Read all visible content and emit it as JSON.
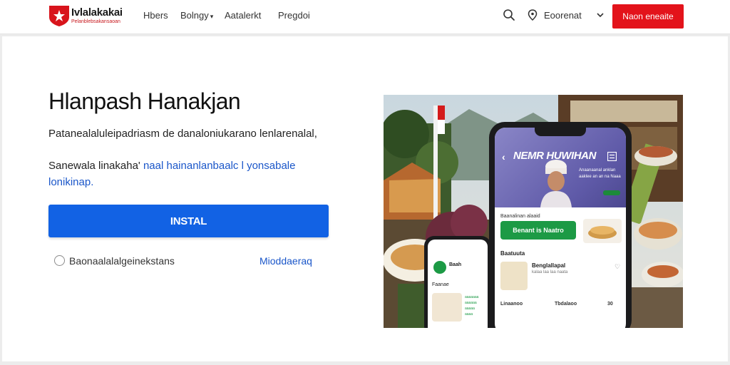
{
  "header": {
    "brand_name": "Ivlalakakai",
    "brand_tagline": "Pelanblebsakansaoan",
    "nav": [
      {
        "label": "Hbers",
        "has_dropdown": false
      },
      {
        "label": "Bolngy",
        "has_dropdown": true
      },
      {
        "label": "Aatalerkt",
        "has_dropdown": false
      },
      {
        "label": "Pregdoi",
        "has_dropdown": false
      }
    ],
    "account_label": "Eoorenat",
    "cta_label": "Naon eneaite",
    "icons": [
      "search-icon",
      "location-pin-icon",
      "chevron-down-icon"
    ]
  },
  "hero": {
    "title": "Hlanpash Hanakjan",
    "lead": "Patanealaluleipadriasm de danaloniukarano lenlarenalal,",
    "sub_text": "Sanewala linakaha'",
    "sub_link": "naal hainanlanbaalc l yonsabale lonikinap.",
    "install_label": "INSTAL",
    "radio_label": "Baonaalalalgeinekstans",
    "more_link": "Mioddaeraq"
  },
  "phone_app": {
    "banner_title": "NEMR HUWIHAN",
    "banner_text": "Anaanaanal anklan aaklee an an na Naaa",
    "kicker": "Baanalinan alaaid",
    "order_button": "Benant is Naatro",
    "section_label": "Baatuuta",
    "menu_items": [
      {
        "name": "Benglallapal",
        "desc": "kalaa laa laa naata"
      },
      {
        "name": "Linaanoo",
        "col2": "Tbdalaoo",
        "col3": "30"
      }
    ]
  },
  "phone_small": {
    "name": "Baah",
    "label": "Faanae",
    "lines": [
      "aaaaaaa",
      "aaaaaa",
      "aaaaa",
      "aaaa"
    ]
  },
  "colors": {
    "brand_red": "#e3131b",
    "primary_blue": "#1262e4",
    "link_blue": "#1a56c9",
    "app_green": "#1c9a45",
    "banner_purple": "#5f5aa8"
  }
}
